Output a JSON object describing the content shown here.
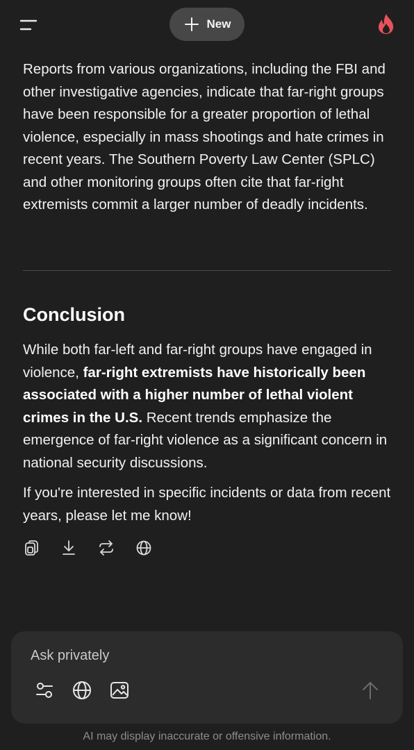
{
  "header": {
    "new_button_label": "New"
  },
  "response": {
    "intro_paragraph": "Reports from various organizations, including the FBI and other investigative agencies, indicate that far-right groups have been responsible for a greater proportion of lethal violence, especially in mass shootings and hate crimes in recent years. The Southern Poverty Law Center (SPLC) and other monitoring groups often cite that far-right extremists commit a larger number of deadly incidents.",
    "section_heading": "Conclusion",
    "conclusion_start": "While both far-left and far-right groups have engaged in violence, ",
    "conclusion_bold": "far-right extremists have historically been associated with a higher number of lethal violent crimes in the U.S.",
    "conclusion_end": " Recent trends emphasize the emergence of far-right violence as a significant concern in national security discussions.",
    "followup": "If you're interested in specific incidents or data from recent years, please let me know!"
  },
  "actions": {
    "icons": [
      "copy-icon",
      "download-icon",
      "regenerate-icon",
      "globe-icon"
    ]
  },
  "composer": {
    "placeholder": "Ask privately",
    "value": "",
    "tool_icons": [
      "filters-icon",
      "web-search-icon",
      "image-icon"
    ],
    "send_icon": "arrow-up-icon"
  },
  "footer": {
    "disclaimer": "AI may display inaccurate or offensive information."
  },
  "colors": {
    "background": "#1f1f1f",
    "pill": "#474747",
    "composer": "#2c2c2c",
    "brand_flame": "#e8525a",
    "muted_text": "#8d8d8d"
  }
}
